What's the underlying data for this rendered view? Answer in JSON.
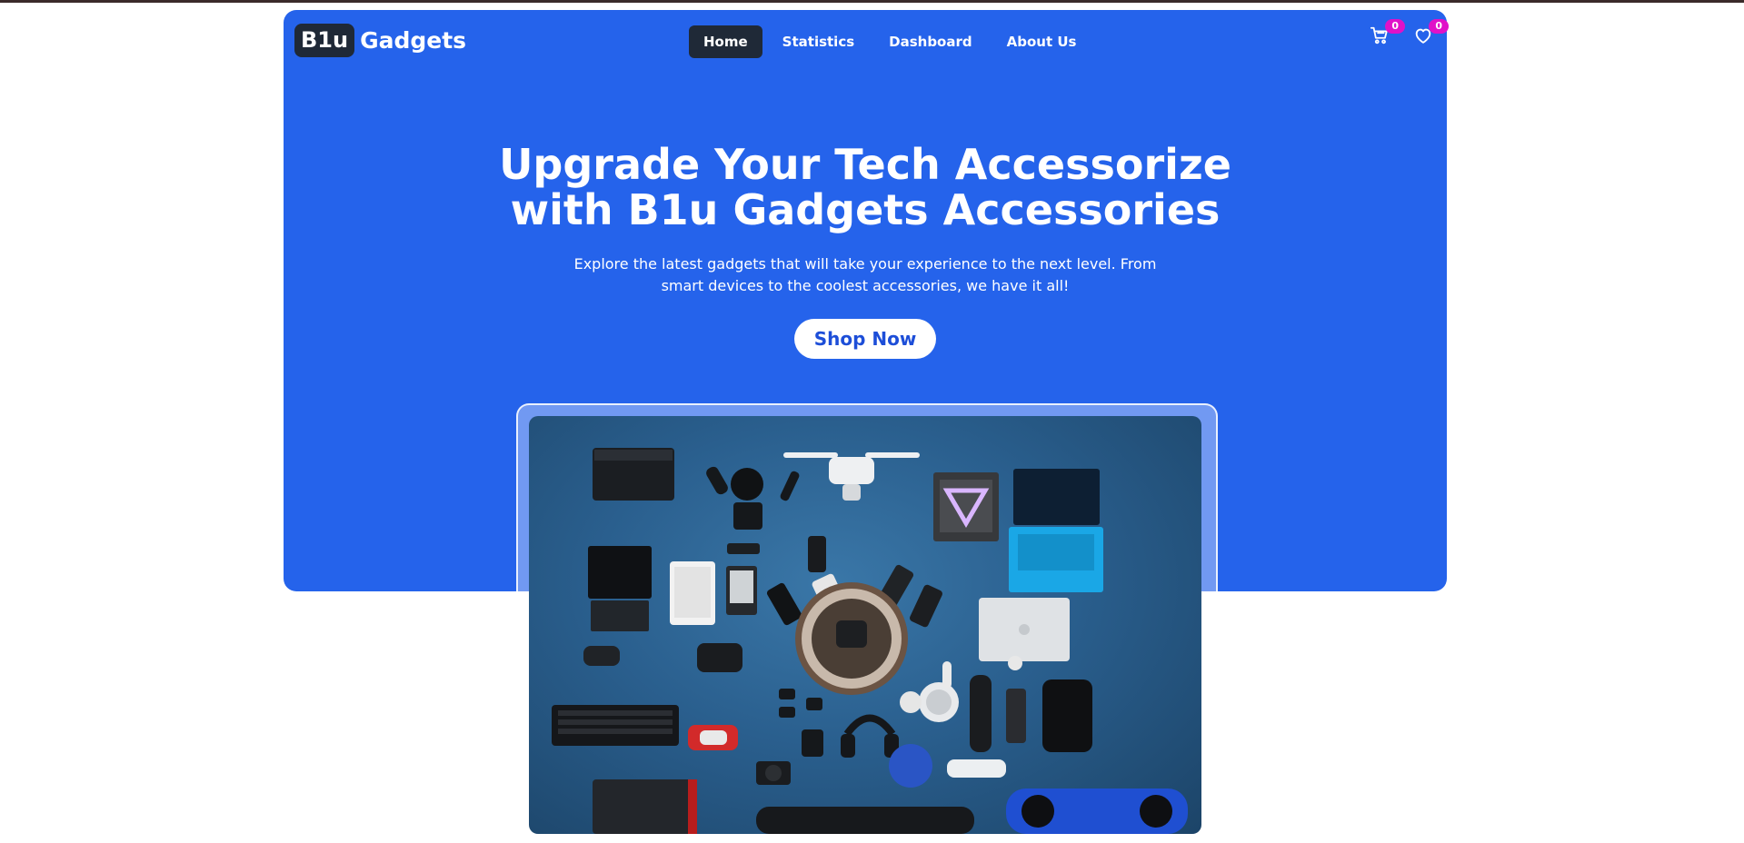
{
  "brand": {
    "logo_box": "B1u",
    "logo_text": "Gadgets"
  },
  "nav": {
    "items": [
      {
        "label": "Home",
        "active": true
      },
      {
        "label": "Statistics",
        "active": false
      },
      {
        "label": "Dashboard",
        "active": false
      },
      {
        "label": "About Us",
        "active": false
      }
    ],
    "cart_count": "0",
    "wishlist_count": "0",
    "cart_icon": "cart-icon",
    "wishlist_icon": "heart-icon"
  },
  "hero": {
    "title_line1": "Upgrade Your Tech Accessorize",
    "title_line2": "with B1u Gadgets Accessories",
    "desc_line1": "Explore the latest gadgets that will take your experience to the next level. From",
    "desc_line2": "smart devices to the coolest accessories, we have it all!",
    "cta_label": "Shop Now"
  },
  "colors": {
    "primary": "#2563eb",
    "nav_active_bg": "#1f2937",
    "badge": "#e011c8",
    "cta_text": "#1d4ed8"
  }
}
